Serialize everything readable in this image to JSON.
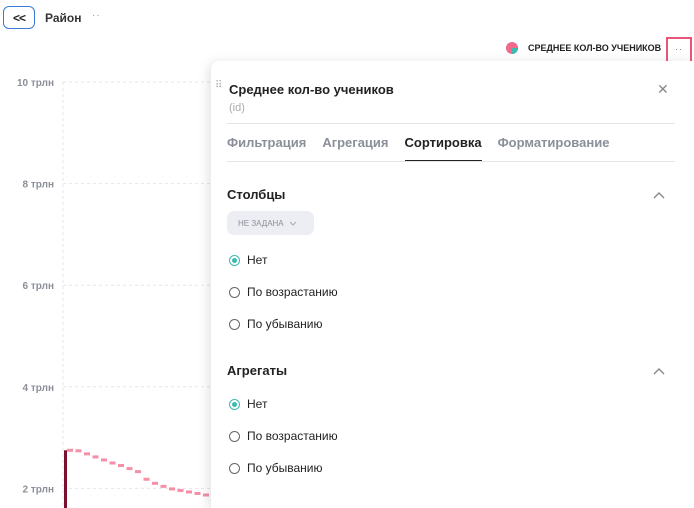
{
  "header": {
    "back_label": "<<",
    "title": "Район",
    "more_label": "··"
  },
  "legend": {
    "label": "СРЕДНЕЕ КОЛ-ВО УЧЕНИКОВ",
    "more_label": "··",
    "icon_colors": [
      "#f06a8c",
      "#3fb8af"
    ]
  },
  "colors": {
    "accent": "#3fb8af",
    "highlight_border": "#e8557a",
    "series": "#f58fa8",
    "bar": "#7a1030"
  },
  "chart_data": {
    "type": "line",
    "y_ticks": [
      "10 трлн",
      "8 трлн",
      "6 трлн",
      "4 трлн",
      "2 трлн"
    ],
    "ylim": [
      0,
      10000000000000
    ],
    "grid": true,
    "series": [
      {
        "name": "СРЕДНЕЕ КОЛ-ВО УЧЕНИКОВ",
        "x": [
          0,
          1,
          2,
          3,
          4,
          5,
          6,
          7,
          8,
          9,
          10,
          11,
          12,
          13,
          14,
          15,
          16
        ],
        "values": [
          2750000000000,
          2740000000000,
          2680000000000,
          2620000000000,
          2560000000000,
          2500000000000,
          2450000000000,
          2390000000000,
          2330000000000,
          2180000000000,
          2100000000000,
          2040000000000,
          1990000000000,
          1960000000000,
          1930000000000,
          1900000000000,
          1870000000000
        ]
      }
    ],
    "bar_values": [
      2750000000000
    ]
  },
  "panel": {
    "drag_label": "⠿",
    "title": "Среднее кол-во учеников",
    "subtitle": "(id)",
    "close_label": "✕",
    "tabs": [
      {
        "label": "Фильтрация"
      },
      {
        "label": "Агрегация"
      },
      {
        "label": "Сортировка"
      },
      {
        "label": "Форматирование"
      }
    ],
    "active_tab": "Сортировка",
    "columns_section": {
      "title": "Столбцы",
      "chip_label": "НЕ ЗАДАНА",
      "options": [
        {
          "label": "Нет",
          "checked": true
        },
        {
          "label": "По возрастанию",
          "checked": false
        },
        {
          "label": "По убыванию",
          "checked": false
        }
      ]
    },
    "aggregates_section": {
      "title": "Агрегаты",
      "options": [
        {
          "label": "Нет",
          "checked": true
        },
        {
          "label": "По возрастанию",
          "checked": false
        },
        {
          "label": "По убыванию",
          "checked": false
        }
      ]
    }
  }
}
